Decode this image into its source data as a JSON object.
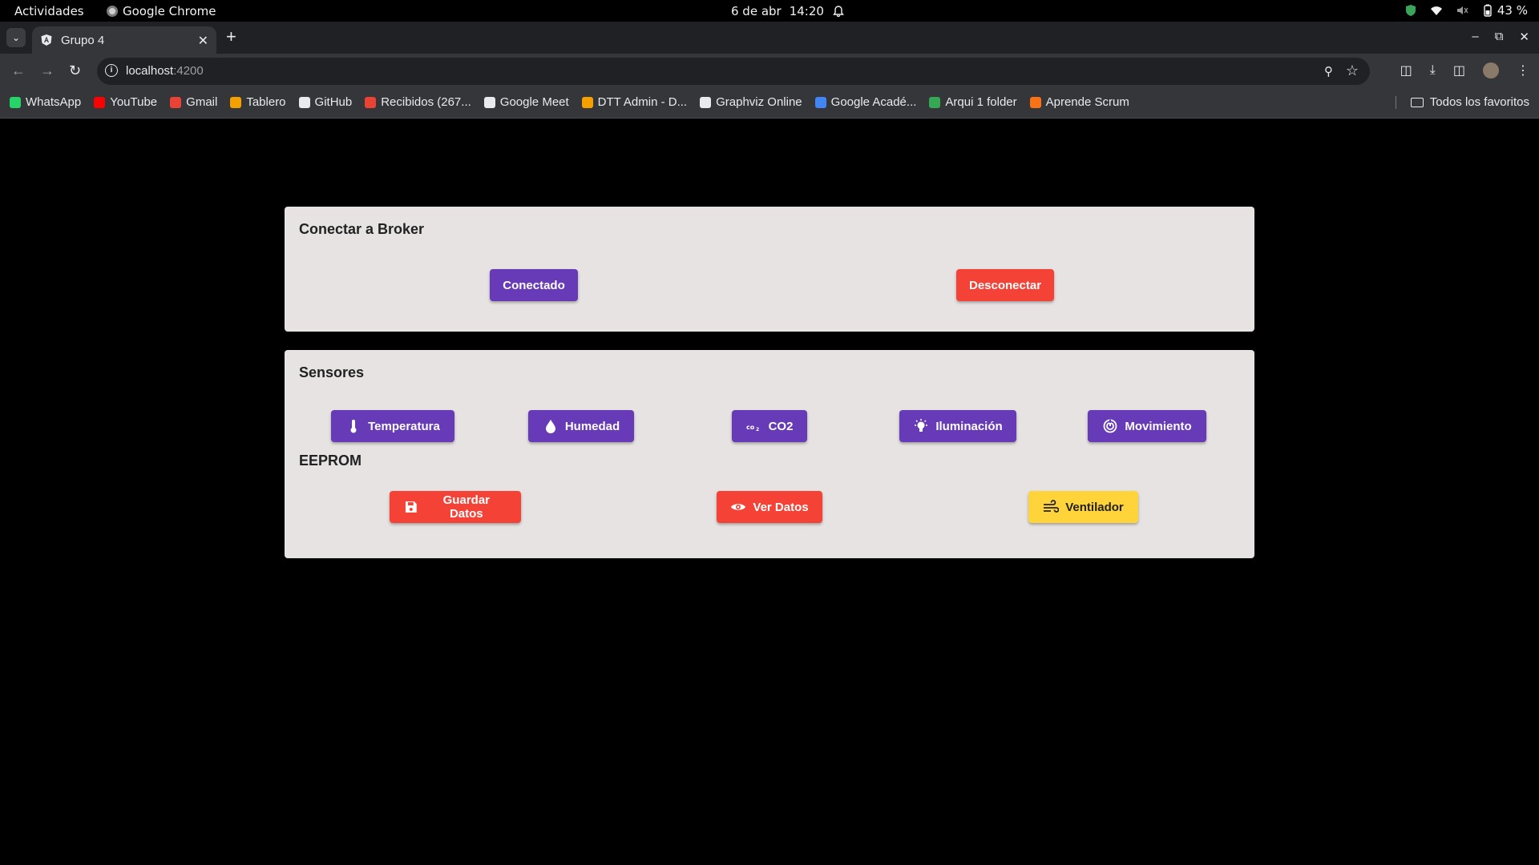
{
  "system": {
    "activities": "Actividades",
    "app_name": "Google Chrome",
    "date": "6 de abr",
    "time": "14:20",
    "battery": "43 %"
  },
  "browser": {
    "tab_title": "Grupo 4",
    "url_host": "localhost",
    "url_port": ":4200",
    "bookmarks": [
      {
        "label": "WhatsApp",
        "color": "#25d366"
      },
      {
        "label": "YouTube",
        "color": "#ff0000"
      },
      {
        "label": "Gmail",
        "color": "#ea4335"
      },
      {
        "label": "Tablero",
        "color": "#f4a100"
      },
      {
        "label": "GitHub",
        "color": "#e8eaed"
      },
      {
        "label": "Recibidos (267...",
        "color": "#ea4335"
      },
      {
        "label": "Google Meet",
        "color": "#e8eaed"
      },
      {
        "label": "DTT Admin - D...",
        "color": "#f4a100"
      },
      {
        "label": "Graphviz Online",
        "color": "#e8eaed"
      },
      {
        "label": "Google Acadé...",
        "color": "#4285f4"
      },
      {
        "label": "Arqui 1 folder",
        "color": "#34a853"
      },
      {
        "label": "Aprende Scrum",
        "color": "#f97316"
      }
    ],
    "all_bookmarks": "Todos los favoritos"
  },
  "broker": {
    "title": "Conectar a Broker",
    "connected_label": "Conectado",
    "disconnect_label": "Desconectar"
  },
  "sensors": {
    "title": "Sensores",
    "temperature_label": "Temperatura",
    "humidity_label": "Humedad",
    "co2_label": "CO2",
    "lighting_label": "Iluminación",
    "motion_label": "Movimiento"
  },
  "eeprom": {
    "title": "EEPROM",
    "save_label": "Guardar Datos",
    "view_label": "Ver Datos",
    "fan_label": "Ventilador"
  },
  "colors": {
    "primary": "#673ab7",
    "warn": "#f44336",
    "accent": "#ffd43b",
    "card_bg": "#e7e3e3"
  }
}
